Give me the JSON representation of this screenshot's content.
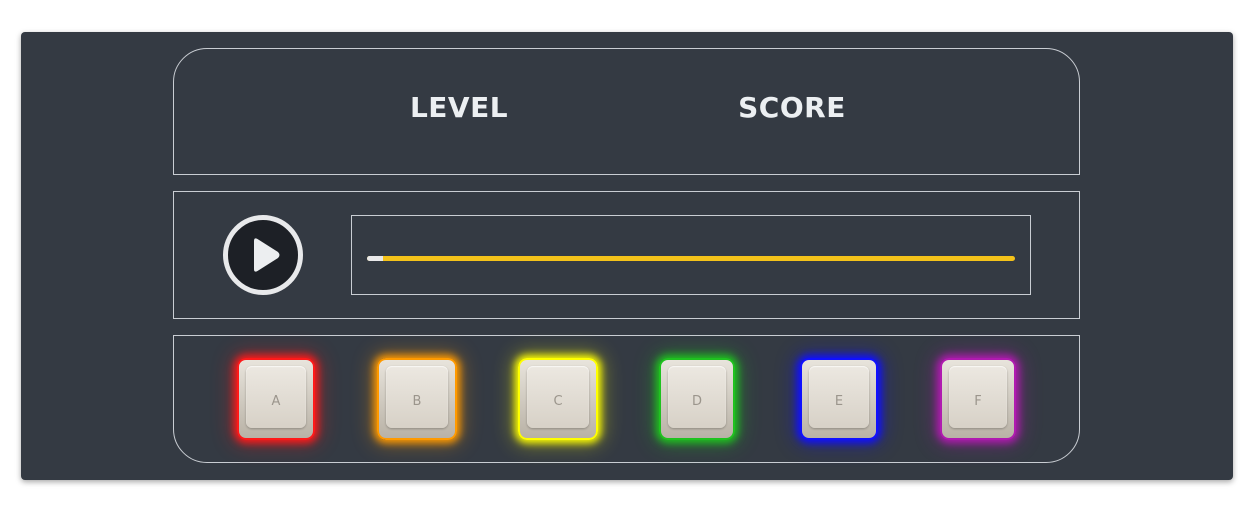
{
  "stats": {
    "level_label": "LEVEL",
    "score_label": "SCORE"
  },
  "controls": {
    "play_icon": "play-icon",
    "progress": 0.025,
    "progress_color": "#f4c21a",
    "progress_fill_color": "#e9e9ea"
  },
  "keys": [
    {
      "letter": "A",
      "color": "#ff1a1a"
    },
    {
      "letter": "B",
      "color": "#ff9a00"
    },
    {
      "letter": "C",
      "color": "#ffff00"
    },
    {
      "letter": "D",
      "color": "#1fc21f"
    },
    {
      "letter": "E",
      "color": "#1010ff"
    },
    {
      "letter": "F",
      "color": "#b01ab0"
    }
  ],
  "theme": {
    "background": "#343a43",
    "panel_border": "#c9cdd3"
  }
}
